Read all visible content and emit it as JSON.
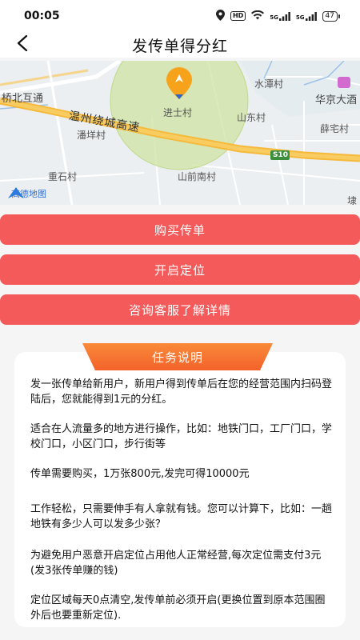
{
  "status_bar": {
    "time": "00:05",
    "signal1": "5G",
    "signal2": "5G",
    "hd": "HD",
    "battery": "47"
  },
  "header": {
    "title": "发传单得分红",
    "back_icon": "chevron-left-icon"
  },
  "map": {
    "labels": {
      "bridge": "桥北互通",
      "shuitan": "水潭村",
      "huajing": "华京大酒",
      "jinshi": "进士村",
      "shandong": "山东村",
      "xuezhai": "薛宅村",
      "highway": "温州绕城高速",
      "panyang": "潘垟村",
      "s10": "S10",
      "shishi": "重石村",
      "shanqian": "山前南村",
      "edge": "埭",
      "brand": "高德地图"
    },
    "colors": {
      "highway": "#f5b93b",
      "circle": "#c8e09a",
      "pin": "#f7a21b"
    }
  },
  "buttons": {
    "buy": "购买传单",
    "locate": "开启定位",
    "consult": "咨询客服了解详情"
  },
  "task": {
    "title": "任务说明",
    "paragraphs": [
      "发一张传单给新用户，新用户得到传单后在您的经营范围内扫码登陆后，您就能得到1元的分红。",
      "适合在人流量多的地方进行操作，比如：地铁门口，工厂门口，学校门口，小区门口，步行街等",
      "传单需要购买，1万张800元,发完可得10000元",
      "工作轻松，只需要伸手有人拿就有钱。您可以计算下，比如：一趟地铁有多少人可以发多少张？",
      "为避免用户恶意开启定位占用他人正常经营,每次定位需支付3元(发3张传单赚的钱)",
      "定位区域每天0点清空,发传单前必须开启(更换位置到原本范围圈外后也要重新定位)."
    ]
  },
  "accent_color": "#f45a5a"
}
